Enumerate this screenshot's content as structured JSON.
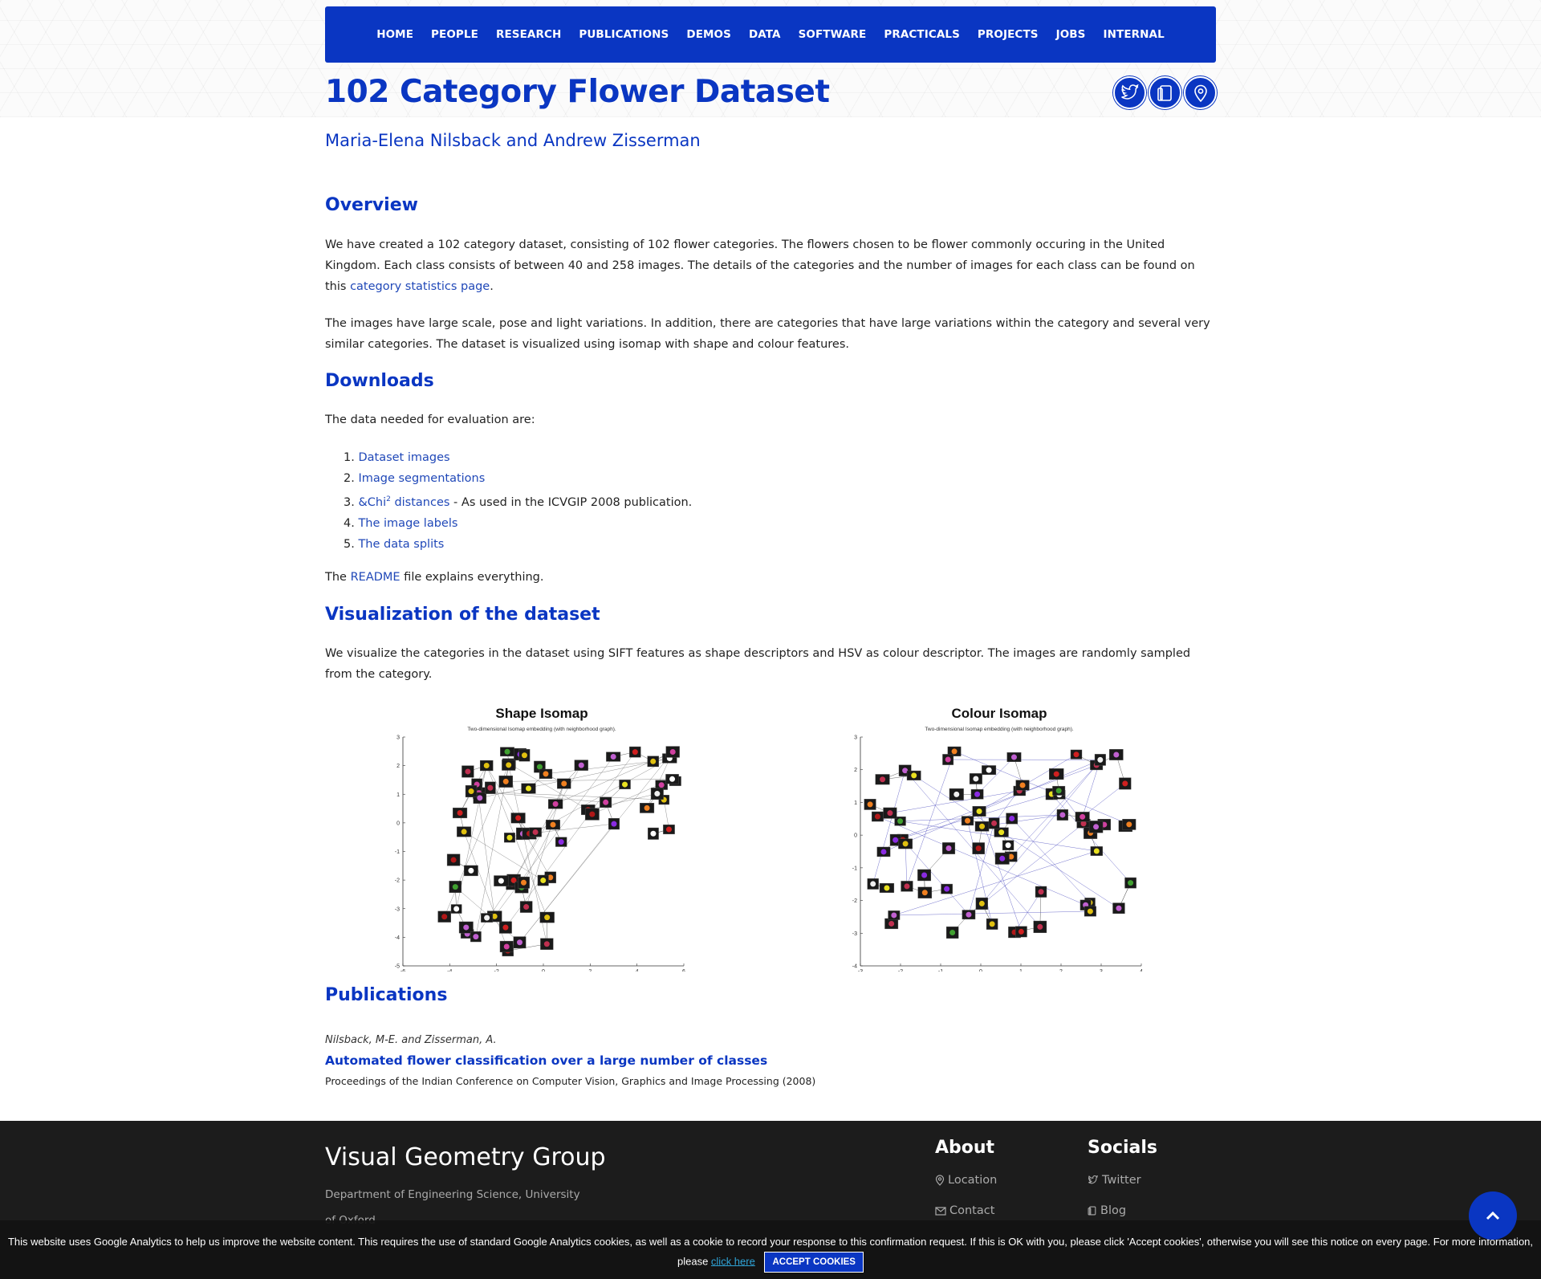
{
  "nav": [
    "HOME",
    "PEOPLE",
    "RESEARCH",
    "PUBLICATIONS",
    "DEMOS",
    "DATA",
    "SOFTWARE",
    "PRACTICALS",
    "PROJECTS",
    "JOBS",
    "INTERNAL"
  ],
  "page": {
    "title": "102 Category Flower Dataset",
    "authors": "Maria-Elena Nilsback and Andrew Zisserman",
    "icons": [
      "twitter-icon",
      "blog-icon",
      "location-icon"
    ]
  },
  "overview": {
    "heading": "Overview",
    "p1_text": "We have created a 102 category dataset, consisting of 102 flower categories. The flowers chosen to be flower commonly occuring in the United Kingdom. Each class consists of between 40 and 258 images. The details of the categories and the number of images for each class can be found on this ",
    "p1_link": "category statistics page",
    "p1_end": ".",
    "p2": "The images have large scale, pose and light variations. In addition, there are categories that have large variations within the category and several very similar categories. The dataset is visualized using isomap with shape and colour features."
  },
  "downloads": {
    "heading": "Downloads",
    "intro": "The data needed for evaluation are:",
    "items": [
      {
        "link": "Dataset images",
        "suffix": ""
      },
      {
        "link": "Image segmentations",
        "suffix": ""
      },
      {
        "link": "&Chi",
        "sup": "2",
        "link2": " distances",
        "suffix": " - As used in the ICVGIP 2008 publication."
      },
      {
        "link": "The image labels",
        "suffix": ""
      },
      {
        "link": "The data splits",
        "suffix": ""
      }
    ],
    "readme_pre": "The ",
    "readme_link": "README",
    "readme_post": " file explains everything."
  },
  "visualization": {
    "heading": "Visualization of the dataset",
    "text": "We visualize the categories in the dataset using SIFT features as shape descriptors and HSV as colour descriptor. The images are randomly sampled from the category.",
    "shape": {
      "title": "Shape Isomap",
      "subtitle": "Two-dimensional Isomap embedding (with neighborhood graph).",
      "xticks": [
        "-6",
        "-4",
        "-2",
        "0",
        "2",
        "4",
        "6"
      ],
      "yticks": [
        "3",
        "2",
        "1",
        "0",
        "-1",
        "-2",
        "-3",
        "-4",
        "-5"
      ]
    },
    "colour": {
      "title": "Colour Isomap",
      "subtitle": "Two-dimensional Isomap embedding (with neighborhood graph).",
      "xticks": [
        "-3",
        "-2",
        "-1",
        "0",
        "1",
        "2",
        "3",
        "4"
      ],
      "yticks": [
        "3",
        "2",
        "1",
        "0",
        "-1",
        "-2",
        "-3",
        "-4"
      ]
    }
  },
  "publications": {
    "heading": "Publications",
    "authors": "Nilsback, M-E. and Zisserman, A.",
    "title": "Automated flower classification over a large number of classes",
    "venue": "Proceedings of the Indian Conference on Computer Vision, Graphics and Image Processing (2008)"
  },
  "footer": {
    "brand": "Visual Geometry Group",
    "dept": "Department of Engineering Science, University of Oxford",
    "about_heading": "About",
    "about_links": [
      "Location",
      "Contact"
    ],
    "socials_heading": "Socials",
    "socials_links": [
      "Twitter",
      "Blog"
    ]
  },
  "cookie": {
    "text": "This website uses Google Analytics to help us improve the website content. This requires the use of standard Google Analytics cookies, as well as a cookie to record your response to this confirmation request. If this is OK with you, please click 'Accept cookies', otherwise you will see this notice on every page. For more information, please ",
    "link": "click here",
    "button": "ACCEPT COOKIES"
  },
  "colors": {
    "brand_blue": "#0a36c2",
    "link_blue": "#2048b8",
    "footer_bg": "#1c1c1c"
  }
}
